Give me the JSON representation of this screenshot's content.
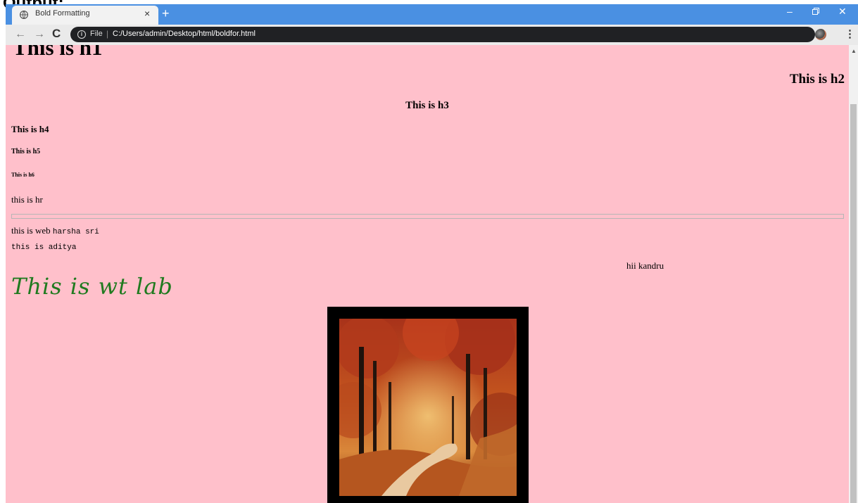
{
  "page_label": "Output:",
  "browser": {
    "tab_title": "Bold Formatting",
    "tab_close": "×",
    "new_tab": "+",
    "omnibox_scheme": "File",
    "omnibox_separator": "|",
    "url": "C:/Users/admin/Desktop/html/boldfor.html",
    "window_min": "–",
    "window_close": "✕",
    "star": "☆",
    "menu": "⋮",
    "back": "←",
    "forward": "→",
    "reload": "C",
    "info": "i"
  },
  "page": {
    "h1": "This is h1",
    "h2": "This is h2",
    "h3": "This is h3",
    "h4": "This is h4",
    "h5": "This is h5",
    "h6": "This is h6",
    "hr_text": "this is hr",
    "web_text": "this is web ",
    "web_mono": "harsha sri",
    "aditya": "this is aditya",
    "kandru": "hii kandru",
    "wt_lab": "This is wt lab",
    "image_subject": "autumn forest path"
  },
  "colors": {
    "page_background": "#ffc0cb",
    "tab_strip": "#4a90e2",
    "wt_lab_text": "#1f7a1f",
    "image_frame": "#000000"
  }
}
